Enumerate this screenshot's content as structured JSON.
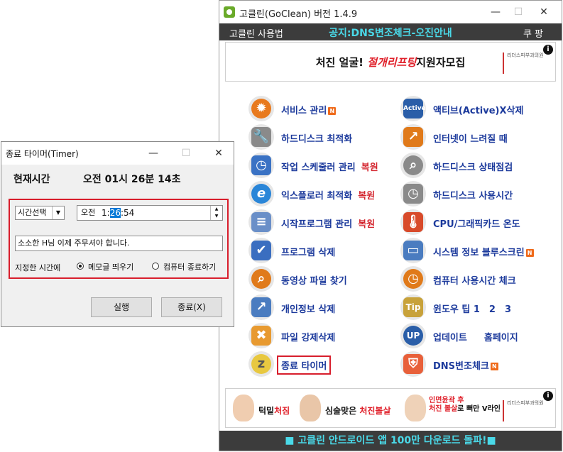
{
  "main_window": {
    "title": "고클린(GoClean) 버전 1.4.9",
    "menu": {
      "left": "고클린 사용법",
      "notice": "공지:DNS변조체크-오진안내",
      "right": "쿠 팡"
    },
    "top_banner": {
      "text_black": "처진 얼굴!",
      "text_red": "절개리프팅",
      "text_black2": "지원자모집",
      "logo_text": "리더스피부과의원",
      "info": "i"
    },
    "items_left": [
      {
        "label": "서비스 관리",
        "badge": "N",
        "icon": "gear-icon",
        "color": "#e87a1e"
      },
      {
        "label": "하드디스크 최적화",
        "icon": "disk-wrench-icon",
        "color": "#8a8a8a"
      },
      {
        "label": "작업 스케줄러 관리",
        "extra": "복원",
        "icon": "scheduler-icon",
        "color": "#3a72c4"
      },
      {
        "label": "익스플로러 최적화",
        "extra": "복원",
        "icon": "ie-icon",
        "color": "#2a86d8"
      },
      {
        "label": "시작프로그램 관리",
        "extra": "복원",
        "icon": "startup-doc-icon",
        "color": "#6a8fc8"
      },
      {
        "label": "프로그램 삭제",
        "icon": "program-delete-icon",
        "color": "#3a6ec0"
      },
      {
        "label": "동영상 파일 찾기",
        "icon": "video-search-icon",
        "color": "#e07a1a"
      },
      {
        "label": "개인정보 삭제",
        "icon": "privacy-delete-icon",
        "color": "#4a7cc0"
      },
      {
        "label": "파일 강제삭제",
        "icon": "file-force-delete-icon",
        "color": "#e89a30"
      },
      {
        "label": "종료 타이머",
        "icon": "timer-bulb-icon",
        "color": "#e8c840",
        "highlighted": true
      }
    ],
    "items_right": [
      {
        "label": "액티브(Active)X삭제",
        "icon": "activex-icon",
        "color": "#2a5ea8"
      },
      {
        "label": "인터넷이 느려질 때",
        "icon": "internet-slow-icon",
        "color": "#e07a1a"
      },
      {
        "label": "하드디스크 상태점검",
        "icon": "disk-check-icon",
        "color": "#8a8a8a"
      },
      {
        "label": "하드디스크 사용시간",
        "icon": "disk-time-icon",
        "color": "#8a8a8a"
      },
      {
        "label": "CPU/그래픽카드 온도",
        "icon": "temperature-icon",
        "color": "#d84a2a"
      },
      {
        "label": "시스템 정보 블루스크린",
        "badge": "N",
        "icon": "system-info-icon",
        "color": "#4a7cc0"
      },
      {
        "label": "컴퓨터 사용시간 체크",
        "icon": "usage-time-icon",
        "color": "#e07a1a"
      },
      {
        "label": "윈도우 팁 1　2　3",
        "icon": "windows-tip-icon",
        "color": "#c8a23a"
      },
      {
        "label": "업데이트",
        "extra2": "홈페이지",
        "icon": "update-icon",
        "color": "#2a5ea8"
      },
      {
        "label": "DNS변조체크",
        "badge": "N",
        "icon": "dns-shield-icon",
        "color": "#e8603a"
      }
    ],
    "bottom_banner": {
      "a_black": "턱밑",
      "a_red": "처짐",
      "b_black": "심술맞은 ",
      "b_red": "처진볼살",
      "c_line1": "인면윤곽 후",
      "c_line2_red": "처진 볼살",
      "c_line2_black": "로 뻐만 V라인",
      "logo_text": "리더스피부과의원",
      "info": "i"
    },
    "footer": "■ 고클린 안드로이드 앱 100만 다운로드 돌파!■"
  },
  "timer_window": {
    "title": "종료 타이머(Timer)",
    "now_label": "현재시간",
    "now_value": "오전 01시 26분 14초",
    "select_value": "시간선택",
    "time_ampm": "오전",
    "time_hour": "1:",
    "time_minute": "26",
    "time_second": ":54",
    "memo": "소소한 H님 이제 주무셔야 합니다.",
    "at_time_label": "지정한 시간에",
    "radio_memo": "메모글 띄우기",
    "radio_shutdown": "컴퓨터 종료하기",
    "run_button": "실행",
    "exit_button": "종료(X)"
  },
  "colors": {
    "accent_cyan": "#4ad9e8",
    "dark_bar": "#3c3c3c",
    "label_blue": "#1c3a9c",
    "highlight_red": "#d81e2c"
  }
}
